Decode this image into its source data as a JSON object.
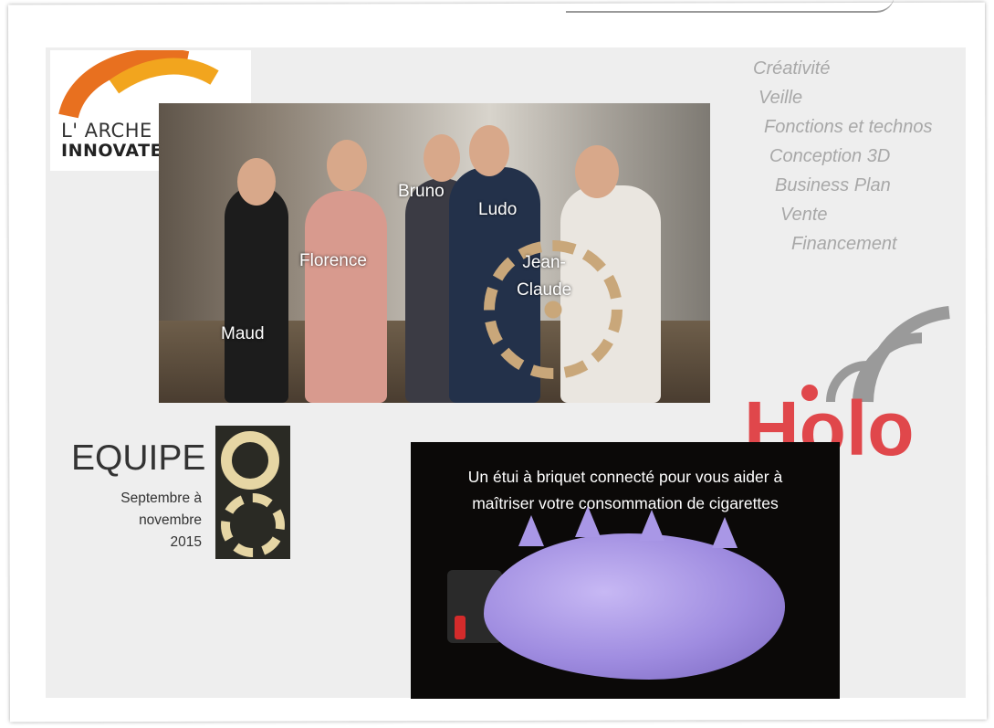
{
  "logo": {
    "line1": "L' ARCHE AUX",
    "line2": "INNOVATEURS",
    "arc_colors": [
      "#e8701f",
      "#f2a51e"
    ]
  },
  "team_photo": {
    "names": [
      "Maud",
      "Florence",
      "Bruno",
      "Ludo",
      "Jean-\nClaude"
    ]
  },
  "topics": [
    "Créativité",
    "Veille",
    "Fonctions et technos",
    "Conception 3D",
    "Business Plan",
    "Vente",
    "Financement"
  ],
  "equipe": {
    "title": "EQUIPE",
    "dates": [
      "Septembre à",
      "novembre",
      "2015"
    ]
  },
  "holo": {
    "word": "Holo",
    "color": "#e0474b",
    "wifi_color": "#9a9a9a"
  },
  "product": {
    "caption_line1": "Un étui à briquet connecté pour vous aider à",
    "caption_line2": "maîtriser votre consommation de cigarettes"
  }
}
